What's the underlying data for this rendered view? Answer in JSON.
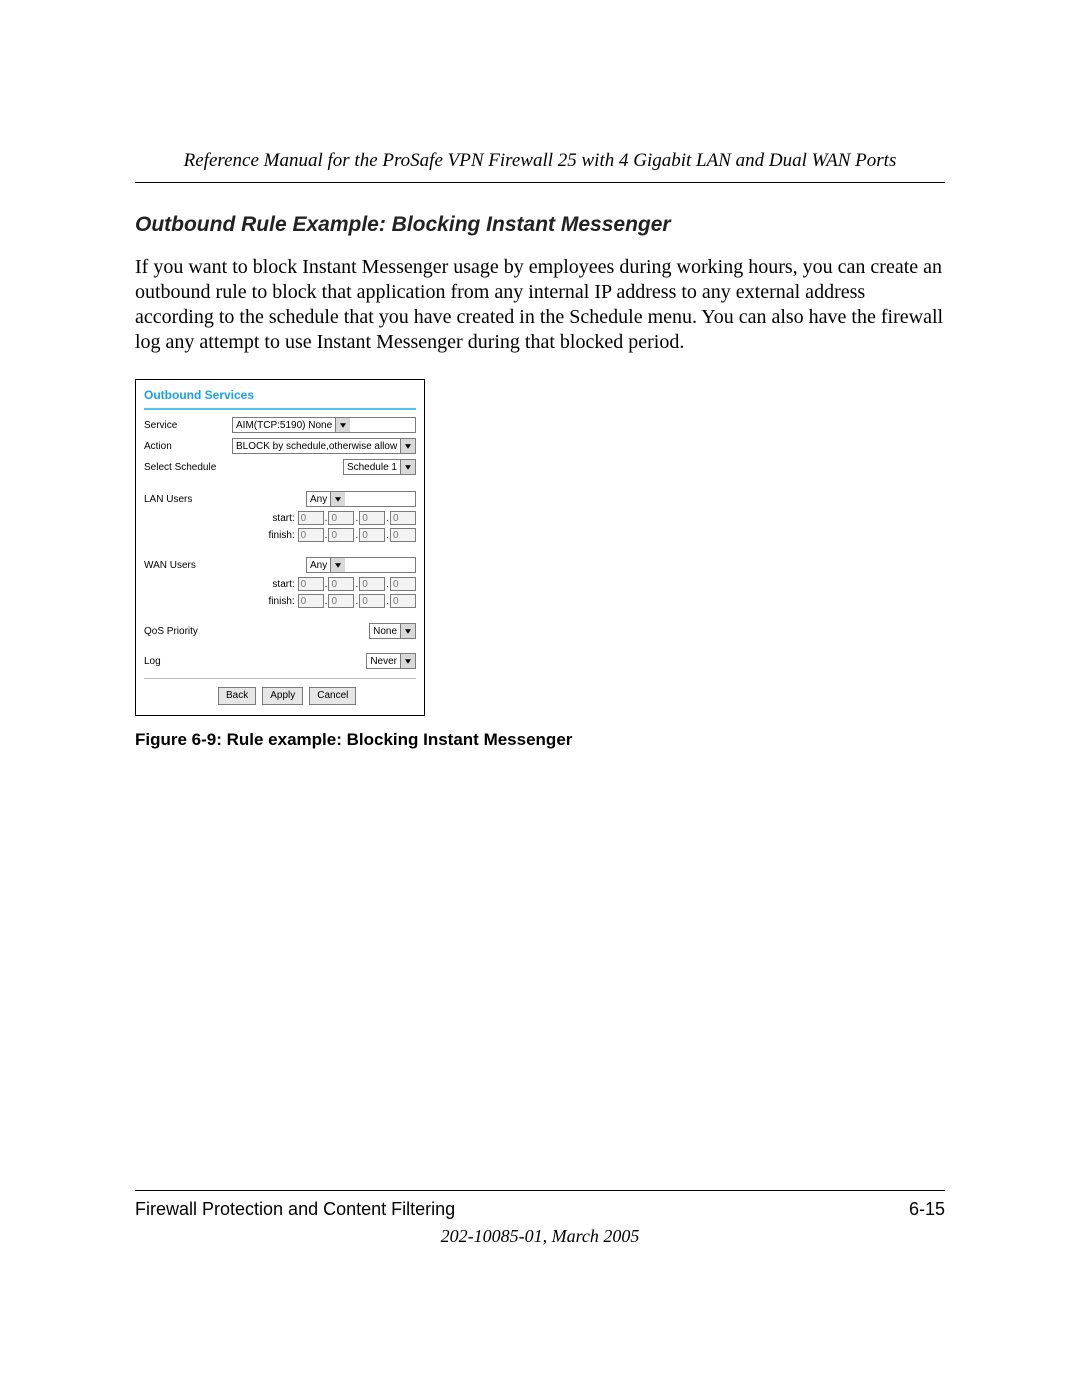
{
  "header": {
    "running_title": "Reference Manual for the ProSafe VPN Firewall 25 with 4 Gigabit LAN and Dual WAN Ports"
  },
  "content": {
    "section_title": "Outbound Rule Example: Blocking Instant Messenger",
    "paragraph": "If you want to block Instant Messenger usage by employees during working hours, you can create an outbound rule to block that application from any internal IP address to any external address according to the schedule that you have created in the Schedule menu. You can also have the firewall log any attempt to use Instant Messenger during that blocked period.",
    "figure_caption": "Figure 6-9:  Rule example: Blocking Instant Messenger"
  },
  "ui": {
    "title": "Outbound Services",
    "labels": {
      "service": "Service",
      "action": "Action",
      "select_schedule": "Select Schedule",
      "lan_users": "LAN Users",
      "wan_users": "WAN Users",
      "qos_priority": "QoS Priority",
      "log": "Log",
      "start": "start:",
      "finish": "finish:"
    },
    "selects": {
      "service": "AIM(TCP:5190) None",
      "action": "BLOCK by schedule,otherwise allow",
      "schedule": "Schedule 1",
      "lan_users": "Any",
      "wan_users": "Any",
      "qos": "None",
      "log": "Never"
    },
    "ip_placeholder": "0",
    "buttons": {
      "back": "Back",
      "apply": "Apply",
      "cancel": "Cancel"
    }
  },
  "footer": {
    "left": "Firewall Protection and Content Filtering",
    "right": "6-15",
    "sub": "202-10085-01, March 2005"
  }
}
